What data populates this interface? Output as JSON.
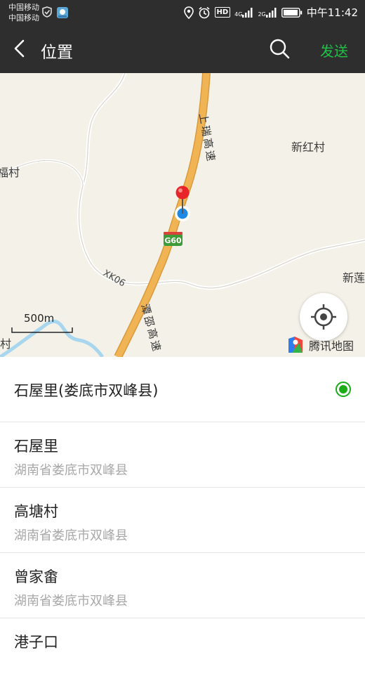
{
  "statusbar": {
    "carrier1": "中国移动",
    "carrier2": "中国移动",
    "network1": "4G",
    "network2": "2G",
    "hd": "HD",
    "time": "中午11:42"
  },
  "titlebar": {
    "title": "位置",
    "send_label": "发送"
  },
  "map": {
    "labels": {
      "xinhongcun": "新红村",
      "fucun": "福村",
      "xinlian": "新莲",
      "cun": "村",
      "road_g60": "G60",
      "road_xk06": "XK06",
      "highway_upper": "上瑞高速",
      "highway_lower": "潭邵高速"
    },
    "scale_label": "500m",
    "brand_label": "腾讯地图",
    "colors": {
      "highway": "#f0b455",
      "pin": "#e8242a",
      "my_location": "#1e88e5",
      "river": "#a8d6ee"
    }
  },
  "list": {
    "selected": {
      "name": "石屋里(娄底市双峰县)"
    },
    "items": [
      {
        "name": "石屋里",
        "address": "湖南省娄底市双峰县"
      },
      {
        "name": "高塘村",
        "address": "湖南省娄底市双峰县"
      },
      {
        "name": "曾家畬",
        "address": "湖南省娄底市双峰县"
      },
      {
        "name": "港子口",
        "address": ""
      }
    ]
  },
  "accent": "#1aad19"
}
